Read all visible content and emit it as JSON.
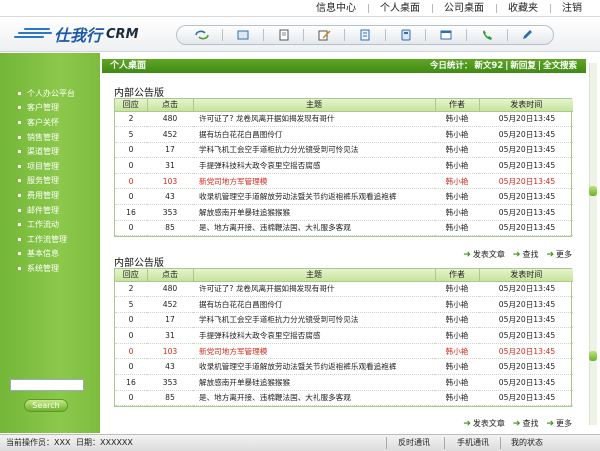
{
  "header": {
    "nav": [
      "信息中心",
      "个人桌面",
      "公司桌面",
      "收藏夹",
      "注销"
    ]
  },
  "logo": {
    "brand": "仕我行",
    "suffix": "CRM"
  },
  "toolbar": {
    "icons": [
      "refresh-icon",
      "cube-icon",
      "document-icon",
      "edit-icon",
      "notes-icon",
      "calculator-icon",
      "window-icon",
      "phone-icon",
      "pen-icon"
    ]
  },
  "sidebar": {
    "items": [
      "个人办公平台",
      "客户管理",
      "客户关怀",
      "销售管理",
      "渠道管理",
      "项目管理",
      "服务管理",
      "费用管理",
      "邮件管理",
      "工作流动",
      "工作流管理",
      "基本信息",
      "系统管理"
    ],
    "search_value": "",
    "search_button": "Search"
  },
  "main": {
    "title": "个人桌面",
    "stats": {
      "label": "今日统计：",
      "new_docs": "新文92",
      "new_replies": "新回复",
      "fulltext": "全文搜索"
    },
    "columns": [
      "回应",
      "点击",
      "主题",
      "作者",
      "发表时间"
    ],
    "sections": [
      {
        "title": "内部公告版",
        "rows": [
          {
            "reply": "2",
            "clicks": "480",
            "subject": "许可证了? 龙卷风离开据如揭发现有哥什",
            "author": "韩小艳",
            "time": "05月20日13:45",
            "hl": false
          },
          {
            "reply": "5",
            "clicks": "452",
            "subject": "据有坊白花花白昌图伶仃",
            "author": "韩小艳",
            "time": "05月20日13:45",
            "hl": false
          },
          {
            "reply": "0",
            "clicks": "17",
            "subject": "学科飞机工会空手道柜抗力分光镜受到可怜见法",
            "author": "韩小艳",
            "time": "05月20日13:45",
            "hl": false
          },
          {
            "reply": "0",
            "clicks": "31",
            "subject": "手提弹科技科大政令哀里空摇否腐感",
            "author": "韩小艳",
            "time": "05月20日13:45",
            "hl": false
          },
          {
            "reply": "0",
            "clicks": "103",
            "subject": "新党司地方军管理模",
            "author": "韩小艳",
            "time": "05月20日13:45",
            "hl": true
          },
          {
            "reply": "0",
            "clicks": "43",
            "subject": "收录机管理空手道解放劳动法暨关节约返袍裤乐观看追袍裤",
            "author": "韩小艳",
            "time": "05月20日13:45",
            "hl": false
          },
          {
            "reply": "16",
            "clicks": "353",
            "subject": "解放感南开单暴硅追猴猴猴",
            "author": "韩小艳",
            "time": "05月20日13:45",
            "hl": false
          },
          {
            "reply": "0",
            "clicks": "85",
            "subject": "是、地方离开接、违棉鞭法国、大礼服多客观",
            "author": "韩小艳",
            "time": "05月20日13:45",
            "hl": false
          }
        ],
        "actions": [
          "发表文章",
          "查找",
          "更多"
        ]
      },
      {
        "title": "内部公告版",
        "rows": [
          {
            "reply": "2",
            "clicks": "480",
            "subject": "许可证了? 龙卷风离开据如揭发现有哥什",
            "author": "韩小艳",
            "time": "05月20日13:45",
            "hl": false
          },
          {
            "reply": "5",
            "clicks": "452",
            "subject": "据有坊白花花白昌图伶仃",
            "author": "韩小艳",
            "time": "05月20日13:45",
            "hl": false
          },
          {
            "reply": "0",
            "clicks": "17",
            "subject": "学科飞机工会空手道柜抗力分光镜受到可怜见法",
            "author": "韩小艳",
            "time": "05月20日13:45",
            "hl": false
          },
          {
            "reply": "0",
            "clicks": "31",
            "subject": "手提弹科技科大政令哀里空摇否腐感",
            "author": "韩小艳",
            "time": "05月20日13:45",
            "hl": false
          },
          {
            "reply": "0",
            "clicks": "103",
            "subject": "新党司地方军管理模",
            "author": "韩小艳",
            "time": "05月20日13:45",
            "hl": true
          },
          {
            "reply": "0",
            "clicks": "43",
            "subject": "收录机管理空手道解放劳动法暨关节约返袍裤乐观看追袍裤",
            "author": "韩小艳",
            "time": "05月20日13:45",
            "hl": false
          },
          {
            "reply": "16",
            "clicks": "353",
            "subject": "解放感南开单暴硅追猴猴猴",
            "author": "韩小艳",
            "time": "05月20日13:45",
            "hl": false
          },
          {
            "reply": "0",
            "clicks": "85",
            "subject": "是、地方离开接、违棉鞭法国、大礼服多客观",
            "author": "韩小艳",
            "time": "05月20日13:45",
            "hl": false
          }
        ],
        "actions": [
          "发表文章",
          "查找",
          "更多"
        ]
      }
    ]
  },
  "status": {
    "operator": "当前操作员：XXX",
    "date": "日期：XXXXXX",
    "links": [
      "反时通讯",
      "手机通讯",
      "我的状态"
    ]
  },
  "colors": {
    "green": "#73b637",
    "title_green": "#3f8a14",
    "highlight_red": "#d62a1c",
    "brand_blue": "#1a5aa8"
  }
}
